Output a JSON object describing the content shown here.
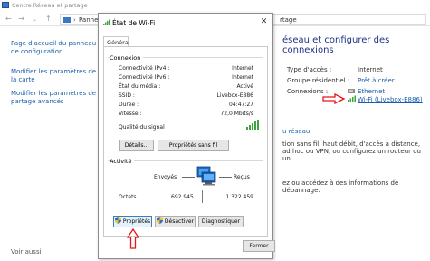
{
  "background": {
    "title": "Centre Réseau et partage",
    "breadcrumb_left": "Panneau",
    "breadcrumb_right": "rtage",
    "sidebar_links": [
      "Page d'accueil du panneau de configuration",
      "Modifier les paramètres de la carte",
      "Modifier les paramètres de partage avancés"
    ],
    "see_also": "Voir aussi",
    "heading": "éseau et configurer des connexions",
    "access_type_label": "Type d'accès :",
    "access_type_value": "Internet",
    "homegroup_label": "Groupe résidentiel :",
    "homegroup_value": "Prêt à créer",
    "connections_label": "Connexions :",
    "ethernet_link": "Ethernet",
    "wifi_link": "Wi-Fi (Livebox-E886)",
    "section_link": "u réseau",
    "body_text_1": "tion sans fil, haut débit, d'accès à distance, ad hoc ou VPN, ou configurez un routeur ou un",
    "body_text_2": "ez ou accédez à des informations de dépannage."
  },
  "dialog": {
    "title": "État de Wi-Fi",
    "tab": "Général",
    "connection_group": "Connexion",
    "rows": [
      {
        "label": "Connectivité IPv4 :",
        "value": "Internet"
      },
      {
        "label": "Connectivité IPv6 :",
        "value": "Internet"
      },
      {
        "label": "État du média :",
        "value": "Activé"
      },
      {
        "label": "SSID :",
        "value": "Livebox-E886"
      },
      {
        "label": "Durée :",
        "value": "04:47:27"
      },
      {
        "label": "Vitesse :",
        "value": "72,0 Mbits/s"
      }
    ],
    "signal_label": "Qualité du signal :",
    "details_button": "Détails...",
    "wireless_props_button": "Propriétés sans fil",
    "activity_group": "Activité",
    "sent_label": "Envoyés",
    "received_label": "Reçus",
    "octets_label": "Octets :",
    "octets_sent": "692 945",
    "octets_received": "1 322 459",
    "properties_button": "Propriétés",
    "disable_button": "Désactiver",
    "diagnose_button": "Diagnostiquer",
    "close_button": "Fermer",
    "accent_color": "#39a53a",
    "arrow_color": "#e8151b"
  }
}
